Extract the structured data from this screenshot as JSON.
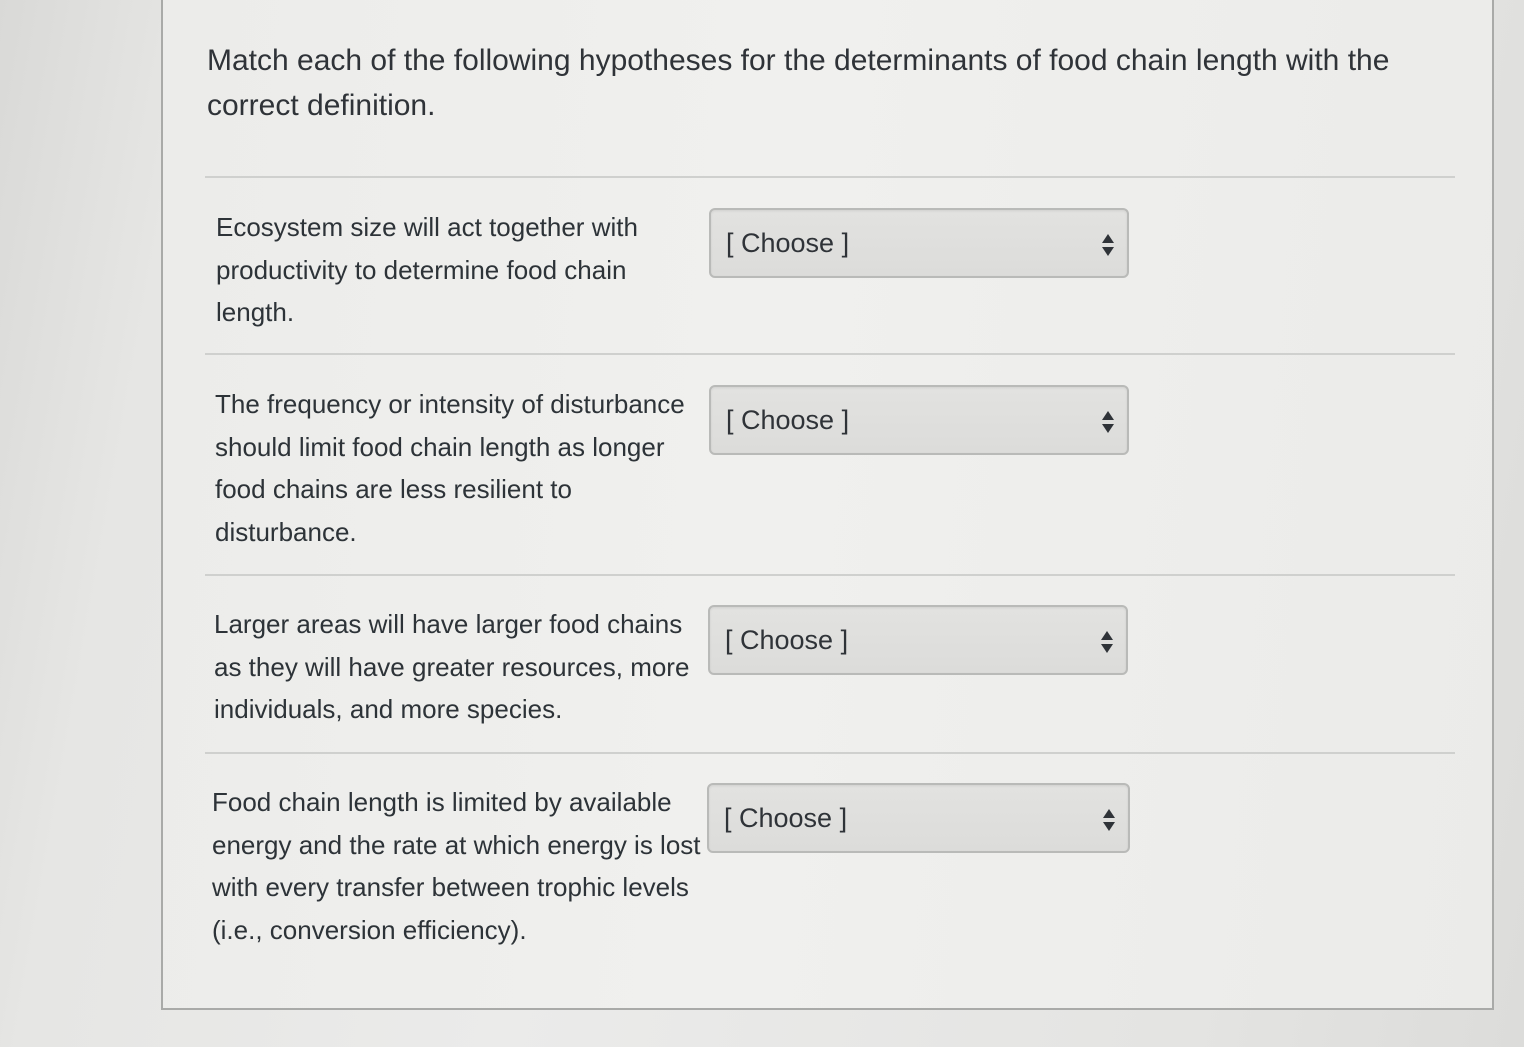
{
  "question": {
    "prompt": "Match each of the following hypotheses for the determinants of food chain length with the correct definition."
  },
  "matches": [
    {
      "hypothesis": "Ecosystem size will act together with productivity to determine food chain length.",
      "selected": "[ Choose ]"
    },
    {
      "hypothesis": "The frequency or intensity of disturbance should limit food chain length as longer food chains are less resilient to disturbance.",
      "selected": "[ Choose ]"
    },
    {
      "hypothesis": "Larger areas will have larger food chains as they will have greater resources, more individuals, and more species.",
      "selected": "[ Choose ]"
    },
    {
      "hypothesis": "Food chain length is limited by available energy and the rate at which energy is lost with every transfer between trophic levels (i.e., conversion efficiency).",
      "selected": "[ Choose ]"
    }
  ],
  "icons": {
    "select_arrows": "up-down-arrows-icon"
  },
  "colors": {
    "text": "#2f3338",
    "select_background": "#dedede",
    "select_border": "#b9bab8",
    "divider": "#cfd0ce"
  }
}
